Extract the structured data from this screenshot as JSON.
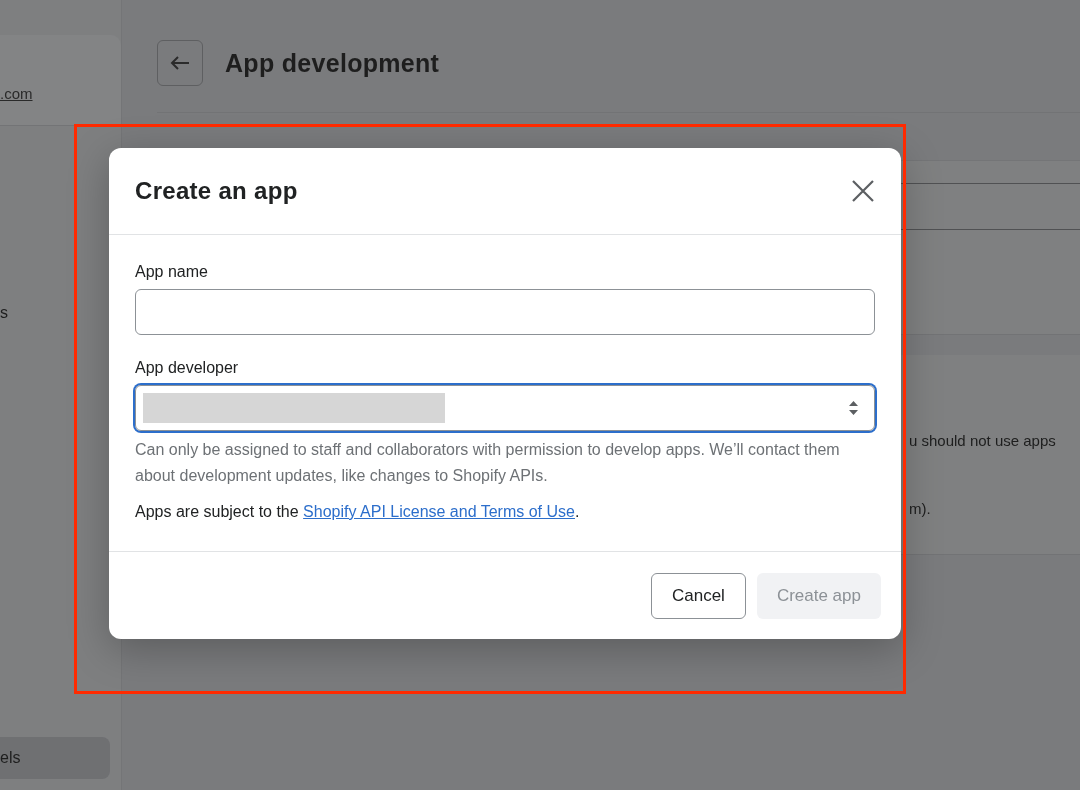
{
  "page": {
    "title": "App development",
    "sidebar": {
      "link": ".com",
      "items": [
        {
          "label": "s",
          "selected": false
        },
        {
          "label": "els",
          "selected": true
        }
      ]
    },
    "notice": {
      "lines": [
        "u should not use apps",
        "m)."
      ]
    }
  },
  "modal": {
    "title": "Create an app",
    "fields": [
      {
        "kind": "text",
        "label": "App name",
        "focused": false
      },
      {
        "kind": "select",
        "label": "App developer",
        "focused": true,
        "help": "Can only be assigned to staff and collaborators with permission to develop apps. We’ll contact them about development updates, like changes to Shopify APIs."
      }
    ],
    "terms": {
      "text": "Apps are subject to the ",
      "link": "Shopify API License and Terms of Use",
      "end": "."
    },
    "buttons": [
      {
        "label": "Cancel",
        "kind": "secondary",
        "disabled": false
      },
      {
        "label": "Create app",
        "kind": "primary",
        "disabled": true
      }
    ]
  },
  "highlight": {
    "color": "#ff2a00"
  }
}
